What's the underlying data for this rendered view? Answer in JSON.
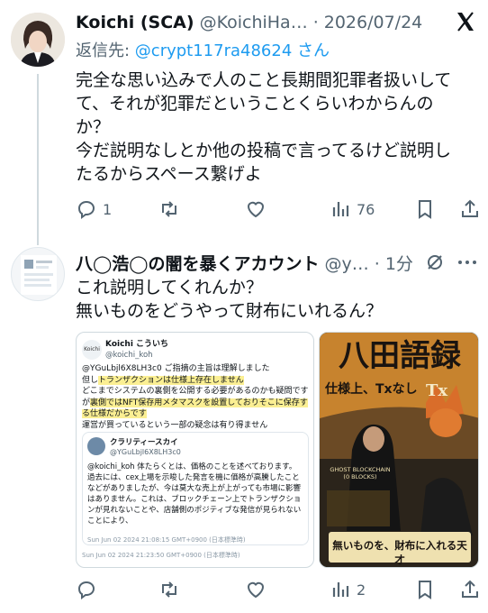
{
  "tweet1": {
    "author_name": "Koichi (SCA)",
    "handle": "@KoichiHa…",
    "dot": "·",
    "date": "2026/07/24",
    "reply_prefix": "返信先: ",
    "reply_handle": "@crypt117ra48624",
    "reply_suffix": " さん",
    "text": "完全な思い込みで人のこと長期間犯罪者扱いして\nて、それが犯罪だということくらいわからんの\nか？\n今だ説明なしとか他の投稿で言ってるけど説明し\nたるからスペース繋げよ",
    "actions": {
      "reply_count": "1",
      "retweet_count": "",
      "like_count": "",
      "views": "76"
    }
  },
  "tweet2": {
    "author_name": "八◯浩◯の闇を暴くアカウント",
    "handle": "@y…",
    "dot": "·",
    "time": "1分",
    "text": "これ説明してくれんか？\n無いものをどうやって財布にいれるん？",
    "actions": {
      "reply_count": "",
      "retweet_count": "",
      "like_count": "",
      "views": "2"
    },
    "image1": {
      "logo": "Koichi",
      "name": "Koichi こういち",
      "handle": "@koichi_koh",
      "line1": "@YGuLbjl6X8LH3c0 ご指摘の主旨は理解しました",
      "line2_pre": "但し",
      "line2_hl": "トランザクションは仕様上存在しません",
      "line3_pre": "どこまでシステムの裏側を公開する必要があるのかも疑問ですが",
      "line3_hl": "裏側ではNFT保存用メタマスクを設置しておりそこに保存する仕様だからです",
      "line4": "運営が買っているという一部の疑念は有り得ません",
      "quote_name": "クラリティースカイ",
      "quote_handle": "@YGuLbjl6X8LH3c0",
      "quote_text": "@koichi_koh 体たらくとは、価格のことを述べております。過去には、cex上場を示唆した発言を機に価格が高騰したことなどがありましたが、今は莫大な売上が上がっても市場に影響はありません。これは、ブロックチェーン上でトランザクションが見れないことや、店舗側のポジティブな発信が見られないことにより、",
      "quote_date": "Sun Jun 02 2024 21:08:15 GMT+0900 (日本標準時)",
      "date": "Sun Jun 02 2024 21:23:50 GMT+0900 (日本標準時)"
    },
    "image2": {
      "title": "八田語録",
      "subtitle": "仕様上、Txなし",
      "badge": "Tx",
      "sign": "GHOST BLOCKCHAIN\n(0 BLOCKS)",
      "tagline": "無いものを、財布に入れる天才"
    }
  },
  "colors": {
    "accent": "#1d9bf0",
    "muted": "#536471",
    "highlight": "#fbef93"
  }
}
